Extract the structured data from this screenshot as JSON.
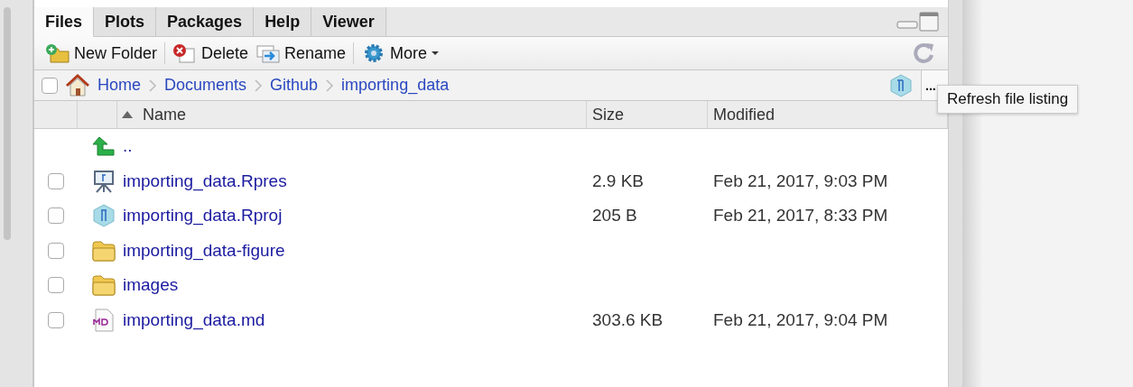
{
  "tabs": [
    {
      "label": "Files",
      "selected": true
    },
    {
      "label": "Plots",
      "selected": false
    },
    {
      "label": "Packages",
      "selected": false
    },
    {
      "label": "Help",
      "selected": false
    },
    {
      "label": "Viewer",
      "selected": false
    }
  ],
  "toolbar": [
    {
      "label": "New Folder",
      "kind": "new-folder"
    },
    {
      "label": "Delete",
      "kind": "delete"
    },
    {
      "label": "Rename",
      "kind": "rename"
    },
    {
      "label": "More",
      "kind": "more"
    }
  ],
  "breadcrumb": {
    "checked": false,
    "items": [
      "Home",
      "Documents",
      "Github",
      "importing_data"
    ]
  },
  "more_button": "...",
  "tooltip": "Refresh file listing",
  "table": {
    "columns": [
      "Name",
      "Size",
      "Modified"
    ],
    "rows": [
      {
        "kind": "parent",
        "name": ".."
      },
      {
        "kind": "rpres",
        "name": "importing_data.Rpres",
        "checked": false,
        "size": "2.9 KB",
        "modified": "Feb 21, 2017, 9:03 PM"
      },
      {
        "kind": "rproj",
        "name": "importing_data.Rproj",
        "checked": false,
        "size": "205 B",
        "modified": "Feb 21, 2017, 8:33 PM"
      },
      {
        "kind": "folder",
        "name": "importing_data-figure",
        "checked": false
      },
      {
        "kind": "folder",
        "name": "images",
        "checked": false
      },
      {
        "kind": "md",
        "name": "importing_data.md",
        "checked": false,
        "size": "303.6 KB",
        "modified": "Feb 21, 2017, 9:04 PM"
      }
    ]
  }
}
